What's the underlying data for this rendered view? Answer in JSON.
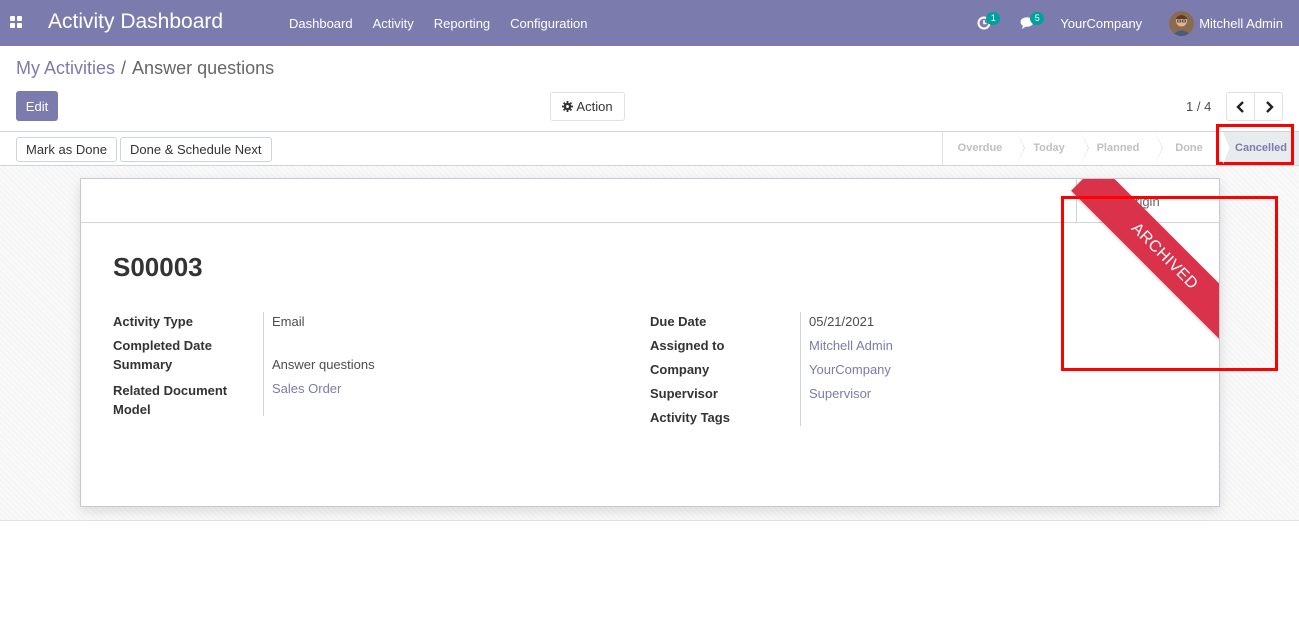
{
  "navbar": {
    "app_title": "Activity Dashboard",
    "menu": [
      "Dashboard",
      "Activity",
      "Reporting",
      "Configuration"
    ],
    "activity_badge": "1",
    "messages_badge": "5",
    "company": "YourCompany",
    "user": "Mitchell Admin",
    "color": "#7c7bad"
  },
  "breadcrumb": {
    "parent": "My Activities",
    "separator": "/",
    "current": "Answer questions"
  },
  "control_panel": {
    "edit_label": "Edit",
    "action_label": "Action",
    "pager_value": "1 / 4"
  },
  "statusbar": {
    "buttons": [
      "Mark as Done",
      "Done & Schedule Next"
    ],
    "stages": [
      "Overdue",
      "Today",
      "Planned",
      "Done",
      "Cancelled"
    ],
    "active_stage": "Cancelled"
  },
  "sheet": {
    "smart_button_label": "Origin",
    "record_name": "S00003",
    "ribbon": "ARCHIVED",
    "ribbon_color": "#d9324a",
    "left_fields": [
      {
        "label": "Activity Type",
        "value": "Email"
      },
      {
        "label": "Completed Date",
        "value": ""
      },
      {
        "label": "Summary",
        "value": "Answer questions"
      },
      {
        "label": "Related Document Model",
        "value": "Sales Order"
      }
    ],
    "right_fields": [
      {
        "label": "Due Date",
        "value": "05/21/2021"
      },
      {
        "label": "Assigned to",
        "value": "Mitchell Admin"
      },
      {
        "label": "Company",
        "value": "YourCompany"
      },
      {
        "label": "Supervisor",
        "value": "Supervisor"
      },
      {
        "label": "Activity Tags",
        "value": ""
      }
    ]
  }
}
